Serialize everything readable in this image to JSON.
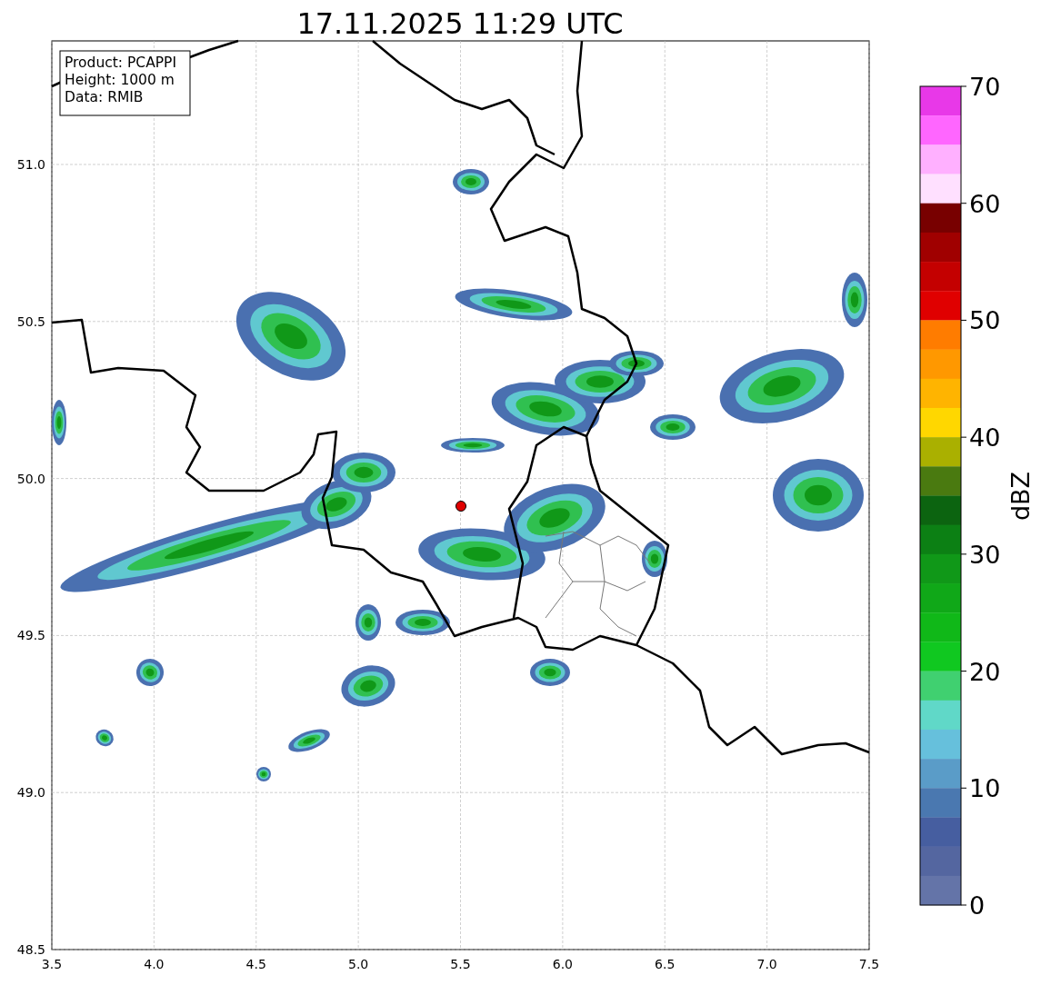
{
  "title": "17.11.2025 11:29 UTC",
  "info_box": [
    "Product: PCAPPI",
    "Height: 1000 m",
    "Data: RMIB"
  ],
  "x_ticks": [
    "3.5",
    "4.0",
    "4.5",
    "5.0",
    "5.5",
    "6.0",
    "6.5",
    "7.0",
    "7.5"
  ],
  "y_ticks": [
    "51.0",
    "50.5",
    "50.0",
    "49.5",
    "49.0",
    "48.5"
  ],
  "colorbar": {
    "label": "dBZ",
    "ticks": [
      "70",
      "60",
      "50",
      "40",
      "30",
      "20",
      "10",
      "0"
    ],
    "segments": [
      {
        "color": "#e838e8"
      },
      {
        "color": "#ff66ff"
      },
      {
        "color": "#ffb0ff"
      },
      {
        "color": "#ffe0ff"
      },
      {
        "color": "#780000"
      },
      {
        "color": "#a00000"
      },
      {
        "color": "#c40000"
      },
      {
        "color": "#e00000"
      },
      {
        "color": "#ff7c00"
      },
      {
        "color": "#ff9800"
      },
      {
        "color": "#ffb400"
      },
      {
        "color": "#ffd700"
      },
      {
        "color": "#aab000"
      },
      {
        "color": "#4a7a10"
      },
      {
        "color": "#0c6410"
      },
      {
        "color": "#0c8014"
      },
      {
        "color": "#109818"
      },
      {
        "color": "#10a818"
      },
      {
        "color": "#10b818"
      },
      {
        "color": "#10c820"
      },
      {
        "color": "#40d070"
      },
      {
        "color": "#60d8c8"
      },
      {
        "color": "#66c0dc"
      },
      {
        "color": "#5a9cc8"
      },
      {
        "color": "#4a78b0"
      },
      {
        "color": "#465ea0"
      },
      {
        "color": "#5466a0"
      },
      {
        "color": "#6474a8"
      }
    ]
  }
}
